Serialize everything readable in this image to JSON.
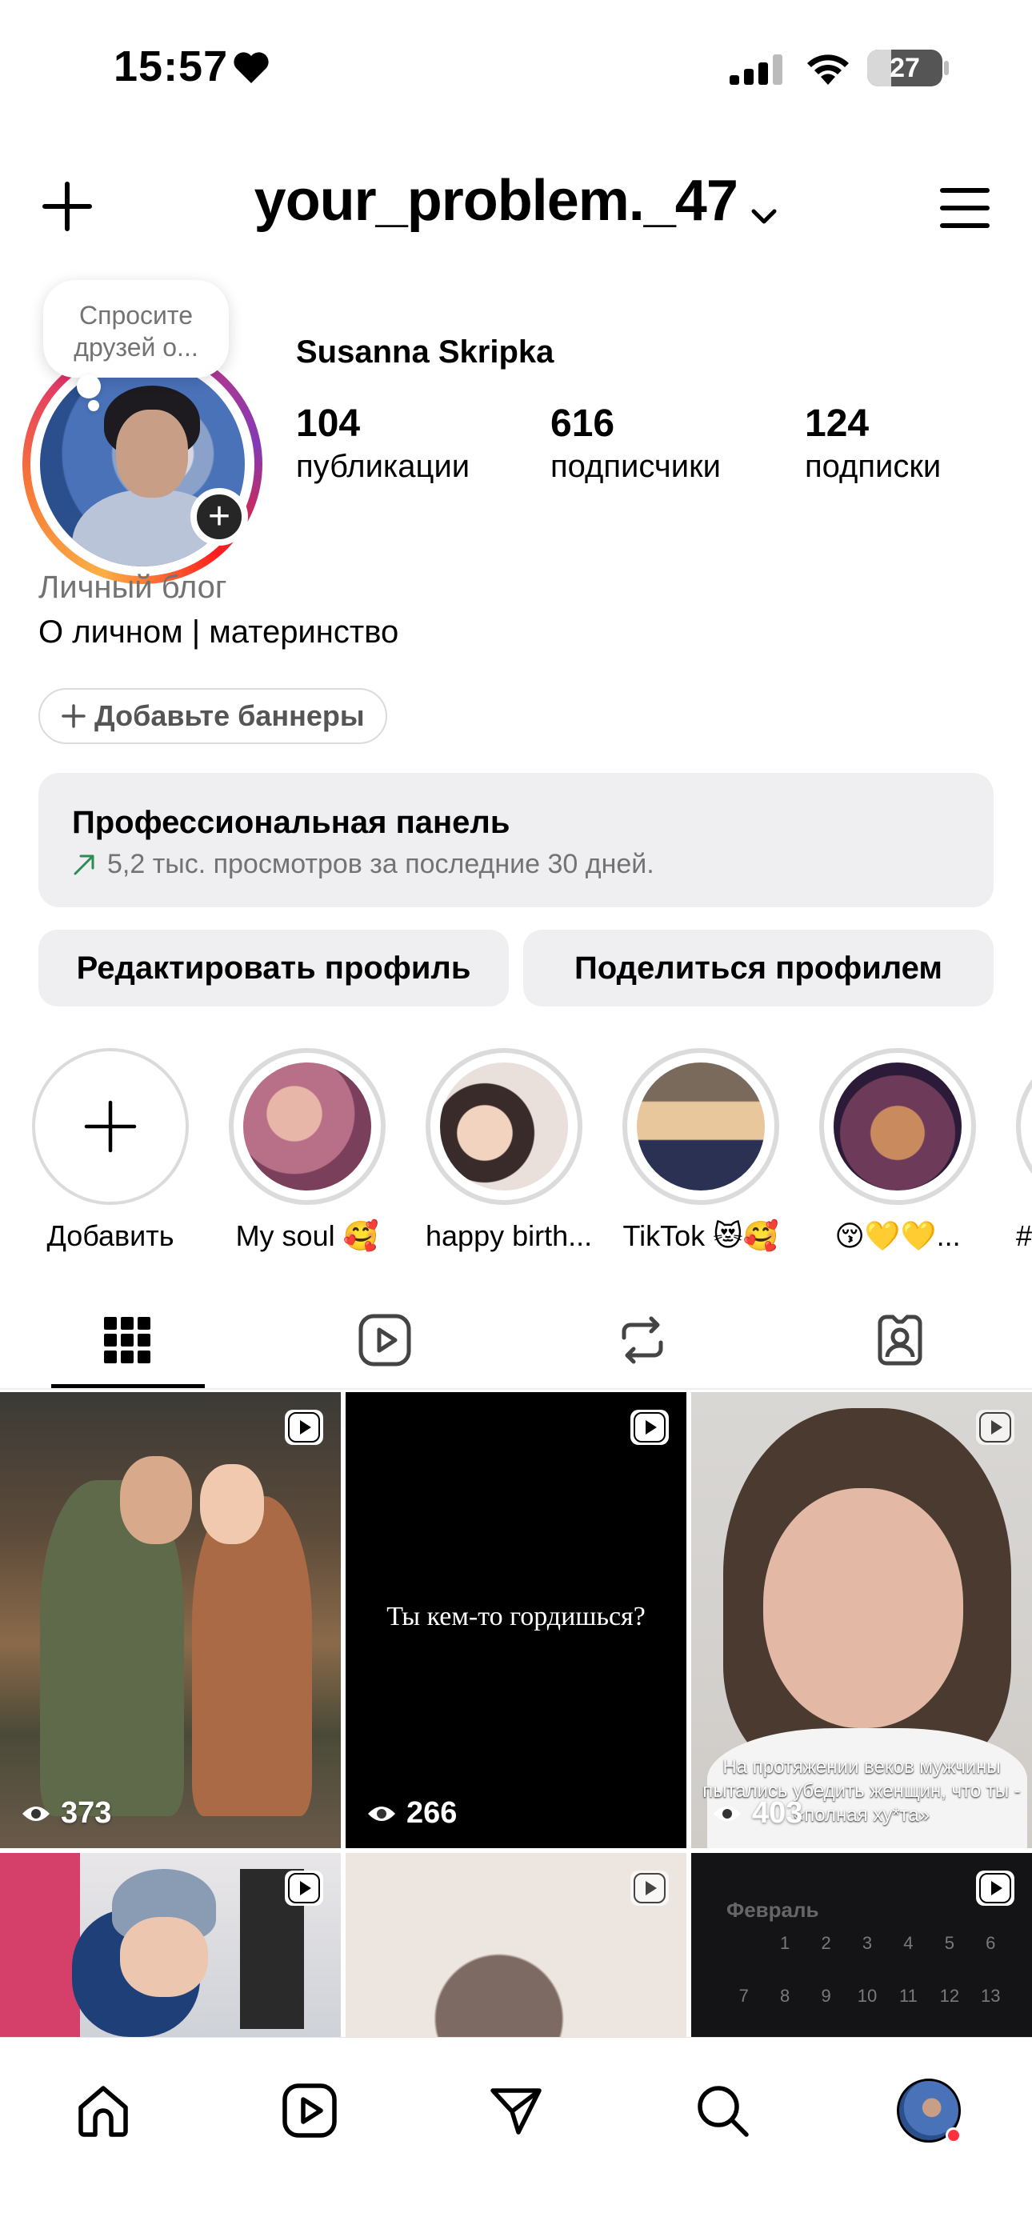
{
  "status_bar": {
    "time": "15:57",
    "battery": "27"
  },
  "header": {
    "username": "your_problem._47"
  },
  "profile": {
    "note_bubble": "Спросите друзей о...",
    "full_name": "Susanna Skripka",
    "stats": [
      {
        "value": "104",
        "label": "публикации"
      },
      {
        "value": "616",
        "label": "подписчики"
      },
      {
        "value": "124",
        "label": "подписки"
      }
    ],
    "category": "Личный блог",
    "bio": "О личном | материнство",
    "banner_button": "Добавьте баннеры"
  },
  "pro_panel": {
    "title": "Профессиональная панель",
    "subtitle": "5,2 тыс. просмотров за последние 30 дней."
  },
  "actions": {
    "edit": "Редактировать профиль",
    "share": "Поделиться профилем"
  },
  "highlights": [
    {
      "label": "Добавить"
    },
    {
      "label": "My soul 🥰"
    },
    {
      "label": "happy birth..."
    },
    {
      "label": "TikTok 😻🥰"
    },
    {
      "label": "😚💛💛..."
    },
    {
      "label": "#"
    }
  ],
  "grid": [
    {
      "views": "373"
    },
    {
      "views": "266",
      "text": "Ты кем-то гордишься?"
    },
    {
      "views": "403",
      "caption": "На протяжении веков мужчины пытались убедить женщин, что ты - «полная ху*та»"
    },
    {},
    {},
    {
      "calendar_month": "Февраль",
      "calendar_days": [
        "1",
        "2",
        "3",
        "4",
        "5",
        "6",
        "7",
        "8",
        "9",
        "10",
        "11",
        "12",
        "13"
      ]
    }
  ],
  "colors": {
    "accent_red": "#ff3040",
    "panel_bg": "#efeff2",
    "secondary_text": "#737373"
  }
}
